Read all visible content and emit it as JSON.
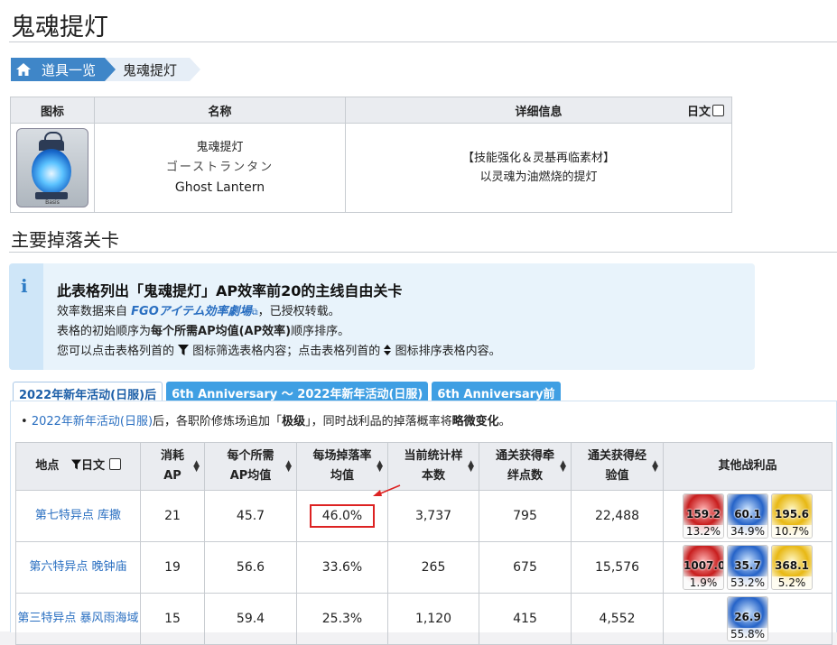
{
  "page": {
    "title": "鬼魂提灯"
  },
  "breadcrumb": {
    "home_icon": "home-icon",
    "parent": "道具一览",
    "current": "鬼魂提灯"
  },
  "item_table": {
    "headers": {
      "icon": "图标",
      "name": "名称",
      "detail": "详细信息",
      "jp_toggle": "日文"
    },
    "icon_label": "Basis",
    "name_cn": "鬼魂提灯",
    "name_jp": "ゴーストランタン",
    "name_en": "Ghost Lantern",
    "detail_line1": "【技能强化＆灵基再临素材】",
    "detail_line2": "以灵魂为油燃烧的提灯"
  },
  "section": {
    "heading": "主要掉落关卡"
  },
  "notice": {
    "icon": "info-icon",
    "title": "此表格列出「鬼魂提灯」AP效率前20的主线自由关卡",
    "line1_prefix": "效率数据来自 ",
    "line1_link": "FGOアイテム効率劇場",
    "line1_suffix": "，已授权转载。",
    "line2_prefix": "表格的初始顺序为",
    "line2_bold": "每个所需AP均值(AP效率)",
    "line2_suffix": "顺序排序。",
    "line3_a": "您可以点击表格列首的",
    "line3_b": "图标筛选表格内容；点击表格列首的",
    "line3_c": "图标排序表格内容。"
  },
  "tabs": [
    {
      "label": "2022年新年活动(日服)后",
      "active": true
    },
    {
      "label": "6th Anniversary ～ 2022年新年活动(日服)",
      "active": false
    },
    {
      "label": "6th Anniversary前",
      "active": false
    }
  ],
  "bullet": {
    "link": "2022年新年活动(日服)",
    "text_a": "后，各职阶修炼场追加「",
    "bold_a": "极级",
    "text_b": "」，同时战利品的掉落概率将",
    "bold_b": "略微变化",
    "text_c": "。"
  },
  "drop_table": {
    "headers": {
      "location": "地点",
      "jp": "日文",
      "ap_1": "消耗",
      "ap_2": "AP",
      "avg_1": "每个所需",
      "avg_2": "AP均值",
      "rate_1": "每场掉落率",
      "rate_2": "均值",
      "samples_1": "当前统计样",
      "samples_2": "本数",
      "bond_1": "通关获得牵",
      "bond_2": "绊点数",
      "exp_1": "通关获得经",
      "exp_2": "验值",
      "other": "其他战利品"
    },
    "rows": [
      {
        "location": "第七特异点 库撒",
        "ap": "21",
        "avg": "45.7",
        "rate": "46.0%",
        "samples": "3,737",
        "bond": "795",
        "exp": "22,488",
        "drops": [
          {
            "color": "red",
            "value": "159.2",
            "pct": "13.2%"
          },
          {
            "color": "blue",
            "value": "60.1",
            "pct": "34.9%"
          },
          {
            "color": "gold",
            "value": "195.6",
            "pct": "10.7%"
          }
        ]
      },
      {
        "location": "第六特异点 晚钟庙",
        "ap": "19",
        "avg": "56.6",
        "rate": "33.6%",
        "samples": "265",
        "bond": "675",
        "exp": "15,576",
        "drops": [
          {
            "color": "red",
            "value": "1007.0",
            "pct": "1.9%"
          },
          {
            "color": "blue",
            "value": "35.7",
            "pct": "53.2%"
          },
          {
            "color": "gold",
            "value": "368.1",
            "pct": "5.2%"
          }
        ]
      },
      {
        "location": "第三特异点 暴风雨海域",
        "ap": "15",
        "avg": "59.4",
        "rate": "25.3%",
        "samples": "1,120",
        "bond": "415",
        "exp": "4,552",
        "drops": [
          {
            "color": "blue",
            "value": "26.9",
            "pct": "55.8%"
          }
        ]
      }
    ]
  }
}
